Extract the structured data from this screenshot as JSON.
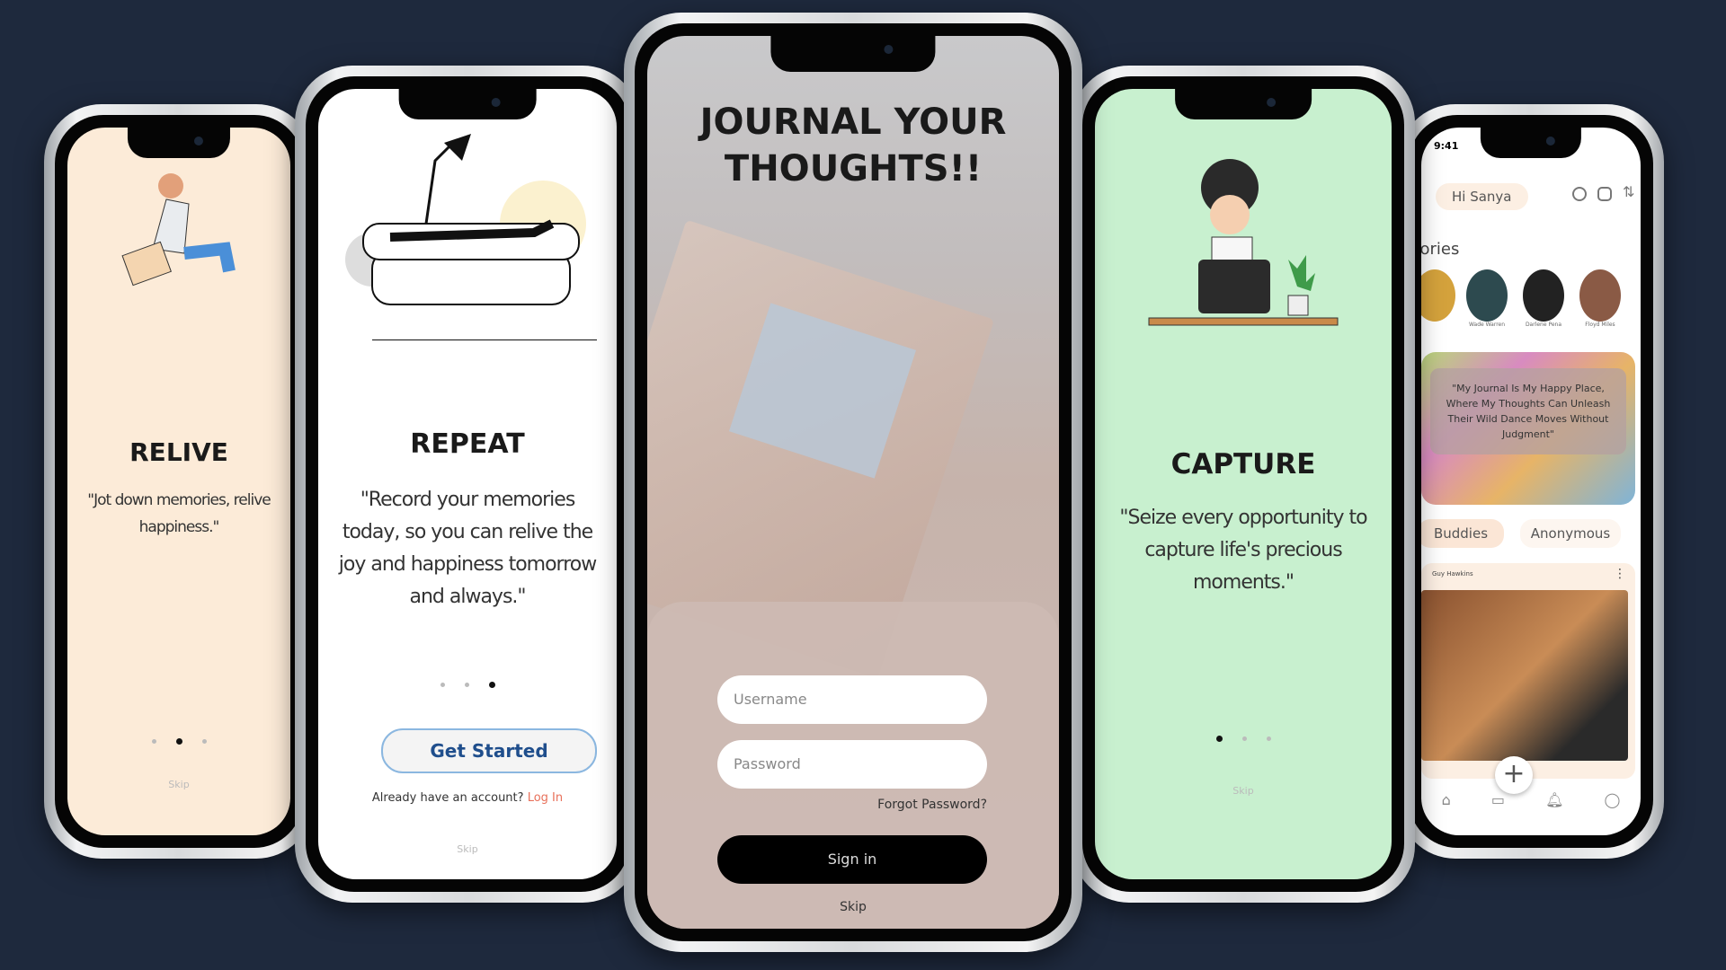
{
  "phones": {
    "relive": {
      "title": "RELIVE",
      "quote": "\"Jot down memories, relive happiness.\"",
      "skip": "Skip",
      "bg": "#fcebd8"
    },
    "repeat": {
      "title": "REPEAT",
      "quote": "\"Record your memories today, so you can relive the joy and happiness tomorrow and always.\"",
      "get_started": "Get Started",
      "account_prompt": "Already have an account?",
      "login": "Log In",
      "skip": "Skip"
    },
    "login": {
      "heading": "JOURNAL YOUR THOUGHTS!!",
      "username_placeholder": "Username",
      "password_placeholder": "Password",
      "forgot": "Forgot Password?",
      "sign_in": "Sign in",
      "skip": "Skip"
    },
    "capture": {
      "title": "CAPTURE",
      "quote": "\"Seize every opportunity to capture life's precious moments.\"",
      "skip": "Skip",
      "bg": "#c8f0cf"
    },
    "home": {
      "time": "9:41",
      "greeting": "Hi Sanya",
      "stories_label": "Stories",
      "stories": [
        "Wade Warren",
        "Darlene Pena",
        "Floyd Miles"
      ],
      "banner_quote": "\"My Journal Is My Happy Place, Where My Thoughts Can Unleash Their Wild Dance Moves Without Judgment\"",
      "tabs": [
        "Buddies",
        "Anonymous"
      ],
      "post_author": "Guy Hawkins"
    }
  }
}
